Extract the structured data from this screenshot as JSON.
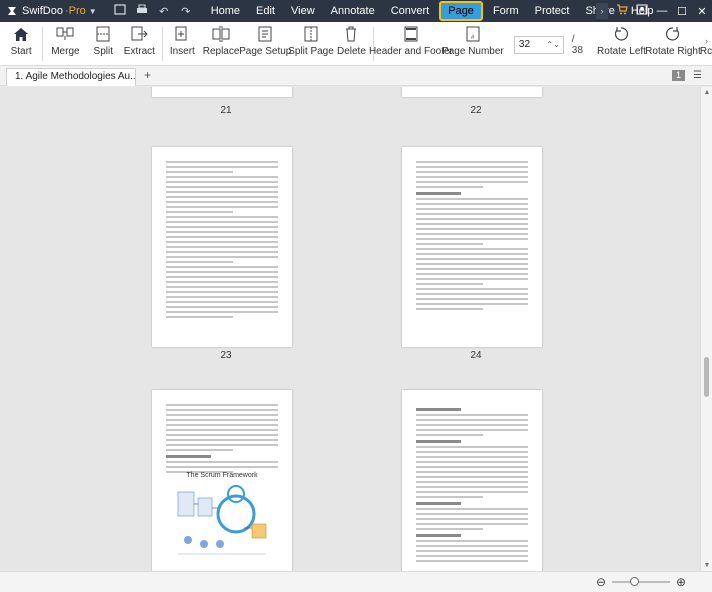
{
  "app": {
    "name": "SwifDoo",
    "edition": "Pro"
  },
  "menu": [
    "Home",
    "Edit",
    "View",
    "Annotate",
    "Convert",
    "Page",
    "Form",
    "Protect",
    "Share",
    "Help"
  ],
  "active_menu": "Page",
  "ribbon": {
    "start": "Start",
    "merge": "Merge",
    "split": "Split",
    "extract": "Extract",
    "insert": "Insert",
    "replace": "Replace",
    "page_setup": "Page Setup",
    "split_page": "Split Page",
    "delete": "Delete",
    "header_footer": "Header and Footer",
    "page_number": "Page Number",
    "current_page": "32",
    "total_pages": "/ 38",
    "rotate_left": "Rotate Left",
    "rotate_right": "Rotate Right",
    "overflow": "Rc"
  },
  "tab": {
    "title": "1. Agile Methodologies Au...pdf",
    "page_count_badge": "1"
  },
  "pages": {
    "p21": "21",
    "p22": "22",
    "p23": "23",
    "p24": "24",
    "figure_title": "The Scrum Framework"
  },
  "colors": {
    "titlebar": "#2b3544",
    "accent": "#3a9bd8",
    "highlight": "#f1c40f",
    "cart": "#f0a830"
  }
}
